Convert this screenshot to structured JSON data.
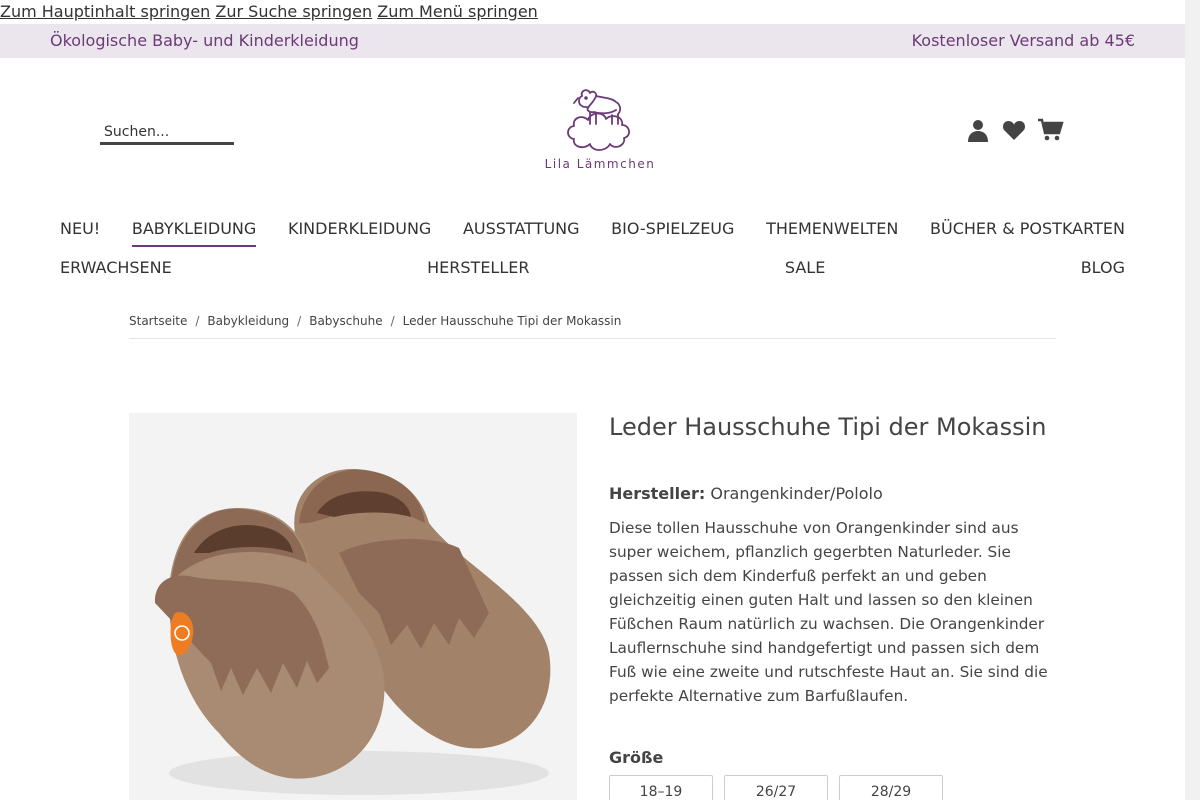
{
  "skip_links": {
    "main": "Zum Hauptinhalt springen",
    "search": "Zur Suche springen",
    "menu": "Zum Menü springen"
  },
  "topbar": {
    "left": "Ökologische Baby- und Kinderkleidung",
    "right": "Kostenloser Versand ab 45€"
  },
  "search": {
    "placeholder": "Suchen..."
  },
  "logo": {
    "text": "Lila Lämmchen"
  },
  "header_icons": [
    "user-icon",
    "heart-icon",
    "cart-icon"
  ],
  "nav": {
    "row1": [
      "NEU!",
      "BABYKLEIDUNG",
      "KINDERKLEIDUNG",
      "AUSSTATTUNG",
      "BIO-SPIELZEUG",
      "THEMENWELTEN",
      "BÜCHER & POSTKARTEN"
    ],
    "row2": [
      "ERWACHSENE",
      "HERSTELLER",
      "SALE",
      "BLOG"
    ],
    "active": "BABYKLEIDUNG"
  },
  "breadcrumb": [
    "Startseite",
    "Babykleidung",
    "Babyschuhe",
    "Leder Hausschuhe Tipi der Mokassin"
  ],
  "product": {
    "title": "Leder Hausschuhe Tipi der Mokassin",
    "maker_label": "Hersteller:",
    "maker": "Orangenkinder/Pololo",
    "description": "Diese tollen Hausschuhe von Orangenkinder sind aus super weichem, pflanzlich gegerbten Naturleder. Sie passen sich dem Kinderfuß perfekt an und geben gleichzeitig einen guten Halt und lassen so den kleinen Füßchen Raum natürlich zu wachsen. Die Orangenkinder Lauflernschuhe sind handgefertigt und passen sich dem Fuß wie eine zweite und rutschfeste Haut an. Sie sind die perfekte Alternative zum Barfußlaufen.",
    "size_label": "Größe",
    "sizes": [
      "18–19",
      "26/27",
      "28/29"
    ]
  },
  "colors": {
    "brand": "#6c3a76",
    "topbar_bg": "#ebe6ee",
    "text": "#444444"
  }
}
